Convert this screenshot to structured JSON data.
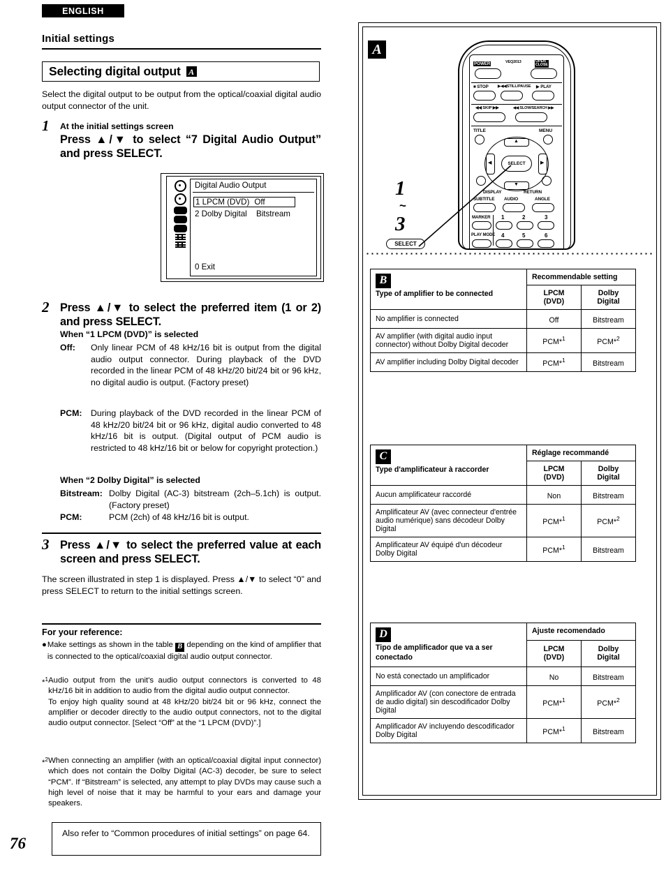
{
  "page": {
    "language_tag": "ENGLISH",
    "page_number": "76",
    "section_title": "Initial settings"
  },
  "heading": {
    "text": "Selecting digital output",
    "ref": "A"
  },
  "intro": "Select the digital output to be output from the optical/coaxial digital audio output connector of the unit.",
  "steps": {
    "step1": {
      "number": "1",
      "subtitle": "At the initial settings screen",
      "instruction": "Press ▲/▼ to select “7 Digital Audio Output” and press SELECT."
    },
    "step2": {
      "number": "2",
      "instruction": "Press ▲/▼ to select the preferred item (1 or 2) and press SELECT.",
      "when_lpcm_heading": "When “1 LPCM (DVD)” is selected",
      "off_term": "Off:",
      "off_desc": "Only linear PCM of 48 kHz/16 bit is output from the digital audio output connector. During playback of the DVD recorded in the linear PCM of 48 kHz/20 bit/24 bit or 96 kHz, no digital audio is output. (Factory preset)",
      "pcm_term": "PCM:",
      "pcm_desc": "During playback of the DVD recorded in the linear PCM of 48 kHz/20 bit/24 bit or 96 kHz, digital audio converted to 48 kHz/16 bit is output. (Digital output of PCM audio is restricted to 48 kHz/16 bit or below for copyright protection.)",
      "when_dolby_heading": "When “2 Dolby Digital” is selected",
      "bitstream_term": "Bitstream:",
      "bitstream_desc": "Dolby Digital (AC-3) bitstream (2ch–5.1ch) is output. (Factory preset)",
      "pcm2_term": "PCM:",
      "pcm2_desc": "PCM (2ch) of 48 kHz/16 bit is output."
    },
    "step3": {
      "number": "3",
      "instruction": "Press ▲/▼ to select the preferred value at each screen and press SELECT.",
      "body": "The screen illustrated in step 1 is displayed. Press ▲/▼ to select “0” and press SELECT to return to the initial settings screen."
    }
  },
  "osd": {
    "title": "Digital Audio Output",
    "row1_label": "1 LPCM (DVD)",
    "row1_value": "Off",
    "row2_label": "2 Dolby Digital",
    "row2_value": "Bitstream",
    "exit": "0 Exit"
  },
  "reference": {
    "heading": "For your reference:",
    "bullet_char": "●",
    "bullet_pre": "Make settings as shown in the table ",
    "bullet_ref": "B",
    "bullet_post": " depending on the kind of amplifier that is connected to the optical/coaxial digital audio output connector.",
    "note1_mark": "*",
    "note1_sup": "1",
    "note1_text": "Audio output from the unit's audio output connectors is converted to 48 kHz/16 bit in addition to audio from the digital audio output connector.",
    "note1_text2": "To enjoy high quality sound at 48 kHz/20 bit/24 bit or 96 kHz, connect the amplifier or decoder directly to the audio output connectors, not to the digital audio output connector. [Select “Off” at the “1 LPCM (DVD)”.]",
    "note2_mark": "*",
    "note2_sup": "2",
    "note2_text": "When connecting an amplifier (with an optical/coaxial digital input connector) which does not contain the Dolby Digital (AC-3) decoder, be sure to select “PCM”. If “Bitstream” is selected, any attempt to play DVDs may cause such a high level of noise that it may be harmful to your ears and damage your speakers."
  },
  "also_box": "Also refer to “Common procedures of initial settings” on page 64.",
  "remote": {
    "tag": "A",
    "model": "VEQ2013",
    "power": "POWER",
    "open_close": "OPEN\nCLOSE",
    "stop": "■ STOP",
    "still_pause": "▶◀◀STILL/PAUSE",
    "play": "▶ PLAY",
    "skip": "◀◀ SKIP ▶▶",
    "slow_search": "◀◀ SLOW/SEARCH ▶▶",
    "slow_word": "SLOW",
    "title": "TITLE",
    "menu": "MENU",
    "select": "SELECT",
    "up_arrow": "▲",
    "down_arrow": "▼",
    "left_arrow": "◀",
    "right_arrow": "▶",
    "display": "DISPLAY",
    "return": "RETURN",
    "subtitle": "SUBTITLE",
    "audio": "AUDIO",
    "angle": "ANGLE",
    "marker": "MARKER",
    "play_mode": "PLAY MODE",
    "num1": "1",
    "num2": "2",
    "num3": "3",
    "num4": "4",
    "num5": "5",
    "num6": "6",
    "callout_from": "1",
    "callout_tilde": "~",
    "callout_to": "3",
    "callout_select": "SELECT"
  },
  "tables": [
    {
      "tag": "B",
      "row_header": "Type of amplifier to be connected",
      "group_header": "Recommendable setting",
      "col1": "LPCM\n(DVD)",
      "col1_a": "LPCM",
      "col1_b": "(DVD)",
      "col2_a": "Dolby",
      "col2_b": "Digital",
      "rows": [
        {
          "label": "No amplifier is connected",
          "lpcm": "Off",
          "lpcm_sup": "",
          "dolby": "Bitstream",
          "dolby_sup": ""
        },
        {
          "label": "AV amplifier (with digital audio input connector) without Dolby Digital decoder",
          "lpcm": "PCM*",
          "lpcm_sup": "1",
          "dolby": "PCM*",
          "dolby_sup": "2"
        },
        {
          "label": "AV amplifier including Dolby Digital decoder",
          "lpcm": "PCM*",
          "lpcm_sup": "1",
          "dolby": "Bitstream",
          "dolby_sup": ""
        }
      ]
    },
    {
      "tag": "C",
      "row_header": "Type d'amplificateur à raccorder",
      "group_header": "Réglage recommandé",
      "col1_a": "LPCM",
      "col1_b": "(DVD)",
      "col2_a": "Dolby",
      "col2_b": "Digital",
      "rows": [
        {
          "label": "Aucun amplificateur raccordé",
          "lpcm": "Non",
          "lpcm_sup": "",
          "dolby": "Bitstream",
          "dolby_sup": ""
        },
        {
          "label": "Amplificateur AV (avec connecteur d'entrée audio numérique) sans décodeur Dolby Digital",
          "lpcm": "PCM*",
          "lpcm_sup": "1",
          "dolby": "PCM*",
          "dolby_sup": "2"
        },
        {
          "label": "Amplificateur AV équipé d'un décodeur Dolby Digital",
          "lpcm": "PCM*",
          "lpcm_sup": "1",
          "dolby": "Bitstream",
          "dolby_sup": ""
        }
      ]
    },
    {
      "tag": "D",
      "row_header": "Tipo de amplificador que va a ser conectado",
      "group_header": "Ajuste recomendado",
      "col1_a": "LPCM",
      "col1_b": "(DVD)",
      "col2_a": "Dolby",
      "col2_b": "Digital",
      "rows": [
        {
          "label": "No está conectado un amplificador",
          "lpcm": "No",
          "lpcm_sup": "",
          "dolby": "Bitstream",
          "dolby_sup": ""
        },
        {
          "label": "Amplificador AV (con conectore de entrada de audio digital) sin descodificador Dolby Digital",
          "lpcm": "PCM*",
          "lpcm_sup": "1",
          "dolby": "PCM*",
          "dolby_sup": "2"
        },
        {
          "label": "Amplificador AV incluyendo descodificador Dolby Digital",
          "lpcm": "PCM*",
          "lpcm_sup": "1",
          "dolby": "Bitstream",
          "dolby_sup": ""
        }
      ]
    }
  ]
}
